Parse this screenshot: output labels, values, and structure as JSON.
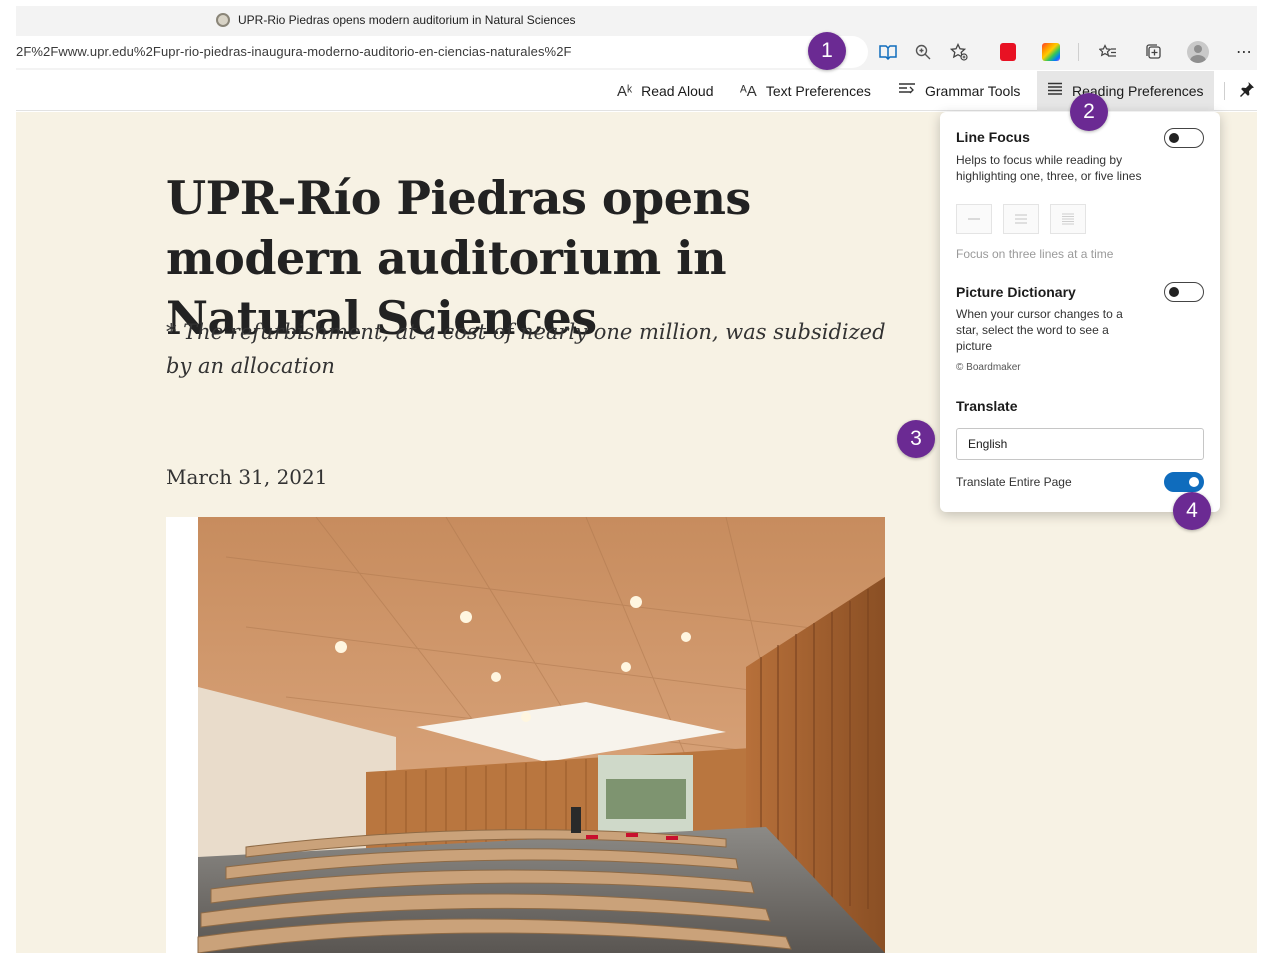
{
  "tab": {
    "title": "UPR-Rio Piedras opens modern auditorium in Natural Sciences"
  },
  "address_bar": {
    "url": "2F%2Fwww.upr.edu%2Fupr-rio-piedras-inaugura-moderno-auditorio-en-ciencias-naturales%2F",
    "more_glyph": "⋯"
  },
  "reader_toolbar": {
    "read_aloud": "Read Aloud",
    "text_preferences": "Text Preferences",
    "grammar_tools": "Grammar Tools",
    "reading_preferences": "Reading Preferences"
  },
  "article": {
    "title": "UPR-Río Piedras opens modern auditorium in Natural Sciences",
    "subtitle": "* The refurbishment, at a cost of nearly one million, was subsidized by an allocation",
    "date": "March 31, 2021"
  },
  "panel": {
    "line_focus": {
      "heading": "Line Focus",
      "description": "Helps to focus while reading by highlighting one, three, or five lines",
      "hint": "Focus on three lines at a time",
      "enabled": false
    },
    "picture_dictionary": {
      "heading": "Picture Dictionary",
      "description": "When your cursor changes to a star, select the word to see a picture",
      "credit": "© Boardmaker",
      "enabled": false
    },
    "translate": {
      "heading": "Translate",
      "language": "English",
      "entire_page_label": "Translate Entire Page",
      "entire_page_enabled": true
    }
  },
  "badges": [
    "1",
    "2",
    "3",
    "4"
  ],
  "colors": {
    "accent": "#0f6cbd",
    "badge": "#6b2a93",
    "reader_bg": "#f7f2e4"
  }
}
